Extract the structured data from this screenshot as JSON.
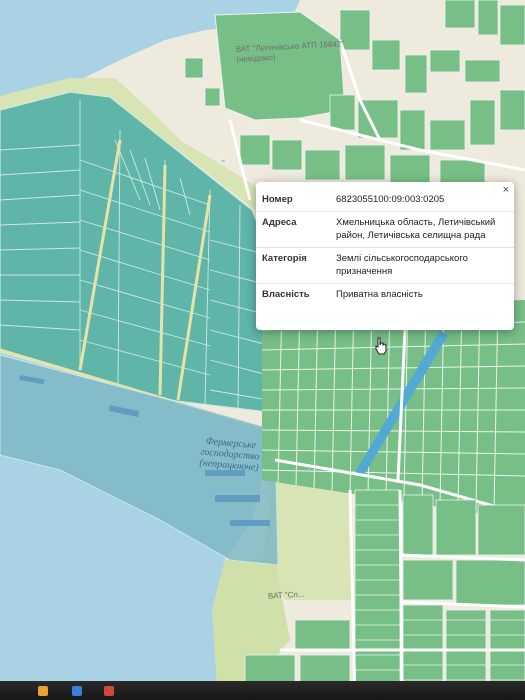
{
  "map": {
    "colors": {
      "water": "#a9d2e4",
      "land": "#eeeadd",
      "meadow": "#d8e4b4",
      "parcel_farm_teal": "#5fb5a8",
      "parcel_green": "#77bf86",
      "parcel_outline": "#e8f4ef",
      "road": "#ffffff",
      "canal": "#54a9d4"
    },
    "labels": {
      "building": "ВАТ \"Летичівське АТП 16842\" (невідомо)",
      "farm": "Фермерське господарство (непрацююче)",
      "lower_small": "ВАТ \"Сп..."
    }
  },
  "popup": {
    "rows": [
      {
        "key": "Номер",
        "value": "6823055100:09:003:0205"
      },
      {
        "key": "Адреса",
        "value": "Хмельницька область, Летичівський район, Летичівська селищна рада"
      },
      {
        "key": "Категорія",
        "value": "Землі сільськогосподарського призначення"
      },
      {
        "key": "Власність",
        "value": "Приватна власність"
      }
    ],
    "close_symbol": "×"
  },
  "icons": {
    "cursor": "hand-pointer-icon",
    "close": "close-icon"
  }
}
